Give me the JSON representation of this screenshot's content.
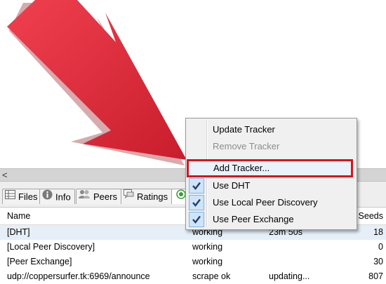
{
  "scrollbar": {
    "left_arrow": "<"
  },
  "tabs": [
    {
      "label": "Files",
      "icon": "files-icon"
    },
    {
      "label": "Info",
      "icon": "info-icon"
    },
    {
      "label": "Peers",
      "icon": "peers-icon"
    },
    {
      "label": "Ratings",
      "icon": "ratings-icon"
    },
    {
      "label": "",
      "icon": "trackers-icon"
    }
  ],
  "grid": {
    "headers": {
      "name": "Name",
      "seeds": "Seeds"
    },
    "rows": [
      {
        "name": "[DHT]",
        "status": "working",
        "update": "23m 50s",
        "seeds": "18"
      },
      {
        "name": "[Local Peer Discovery]",
        "status": "working",
        "update": "",
        "seeds": "0"
      },
      {
        "name": "[Peer Exchange]",
        "status": "working",
        "update": "",
        "seeds": "30"
      },
      {
        "name": "udp://coppersurfer.tk:6969/announce",
        "status": "scrape ok",
        "update": "updating...",
        "seeds": "807"
      }
    ]
  },
  "context_menu": {
    "items": [
      {
        "label": "Update Tracker",
        "enabled": true,
        "checked": false
      },
      {
        "label": "Remove Tracker",
        "enabled": false,
        "checked": false
      },
      {
        "label": "Add Tracker...",
        "enabled": true,
        "checked": false,
        "highlighted": true
      },
      {
        "label": "Use DHT",
        "enabled": true,
        "checked": true
      },
      {
        "label": "Use Local Peer Discovery",
        "enabled": true,
        "checked": true
      },
      {
        "label": "Use Peer Exchange",
        "enabled": true,
        "checked": true
      }
    ]
  },
  "colors": {
    "arrow": "#e8283a",
    "highlight_border": "#d9141c",
    "check_bg": "#cfe4f7"
  }
}
